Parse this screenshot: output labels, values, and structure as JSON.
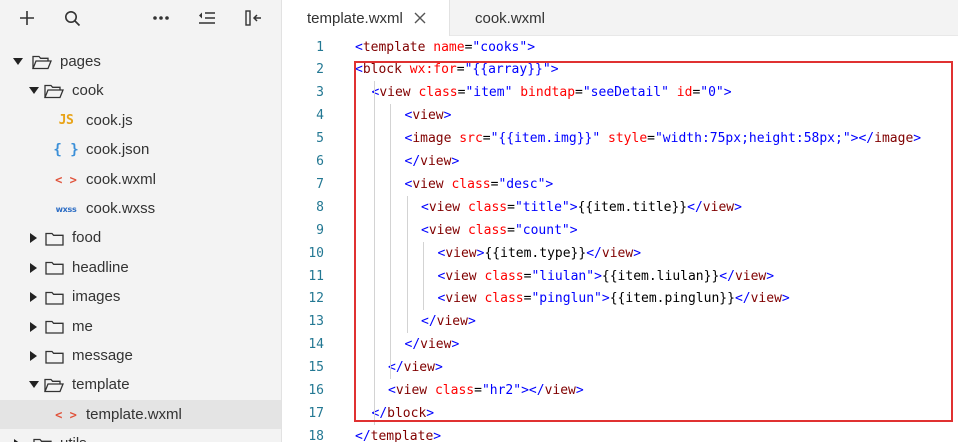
{
  "toolbar": {
    "icons": [
      "plus-icon",
      "search-icon",
      "more-icon",
      "outdent-icon",
      "collapse-panel-icon"
    ]
  },
  "tree": [
    {
      "label": "pages",
      "type": "folder",
      "expanded": true,
      "depth": 0
    },
    {
      "label": "cook",
      "type": "folder",
      "expanded": true,
      "depth": 1
    },
    {
      "label": "cook.js",
      "type": "js",
      "depth": 2
    },
    {
      "label": "cook.json",
      "type": "json",
      "depth": 2
    },
    {
      "label": "cook.wxml",
      "type": "wxml",
      "depth": 2
    },
    {
      "label": "cook.wxss",
      "type": "wxss",
      "depth": 2
    },
    {
      "label": "food",
      "type": "folder",
      "expanded": false,
      "depth": 1
    },
    {
      "label": "headline",
      "type": "folder",
      "expanded": false,
      "depth": 1
    },
    {
      "label": "images",
      "type": "folder",
      "expanded": false,
      "depth": 1
    },
    {
      "label": "me",
      "type": "folder",
      "expanded": false,
      "depth": 1
    },
    {
      "label": "message",
      "type": "folder",
      "expanded": false,
      "depth": 1
    },
    {
      "label": "template",
      "type": "folder",
      "expanded": true,
      "depth": 1
    },
    {
      "label": "template.wxml",
      "type": "wxml",
      "depth": 2,
      "selected": true
    },
    {
      "label": "utils",
      "type": "folder",
      "expanded": false,
      "depth": 0
    }
  ],
  "icon_glyphs": {
    "js": "JS",
    "json": "{ }",
    "wxml": "< >",
    "wxss": "wxss"
  },
  "tabs": [
    {
      "label": "template.wxml",
      "active": true
    },
    {
      "label": "cook.wxml",
      "active": false
    }
  ],
  "code_lines": [
    {
      "n": "1",
      "indent": 0,
      "tokens": [
        [
          "c-tag2",
          "<"
        ],
        [
          "c-tag",
          "template"
        ],
        [
          "c-text",
          " "
        ],
        [
          "c-attr",
          "name"
        ],
        [
          "c-text",
          "="
        ],
        [
          "c-val",
          "\"cooks\""
        ],
        [
          "c-tag2",
          ">"
        ]
      ]
    },
    {
      "n": "2",
      "indent": 0,
      "tokens": [
        [
          "c-tag2",
          "<"
        ],
        [
          "c-tag",
          "block"
        ],
        [
          "c-text",
          " "
        ],
        [
          "c-attr",
          "wx:for"
        ],
        [
          "c-text",
          "="
        ],
        [
          "c-val",
          "\"{{array}}\""
        ],
        [
          "c-tag2",
          ">"
        ]
      ]
    },
    {
      "n": "3",
      "indent": 1,
      "tokens": [
        [
          "c-tag2",
          "<"
        ],
        [
          "c-tag",
          "view"
        ],
        [
          "c-text",
          " "
        ],
        [
          "c-attr",
          "class"
        ],
        [
          "c-text",
          "="
        ],
        [
          "c-val",
          "\"item\""
        ],
        [
          "c-text",
          " "
        ],
        [
          "c-attr",
          "bindtap"
        ],
        [
          "c-text",
          "="
        ],
        [
          "c-val",
          "\"seeDetail\""
        ],
        [
          "c-text",
          " "
        ],
        [
          "c-attr",
          "id"
        ],
        [
          "c-text",
          "="
        ],
        [
          "c-val",
          "\"0\""
        ],
        [
          "c-tag2",
          ">"
        ]
      ]
    },
    {
      "n": "4",
      "indent": 3,
      "tokens": [
        [
          "c-tag2",
          "<"
        ],
        [
          "c-tag",
          "view"
        ],
        [
          "c-tag2",
          ">"
        ]
      ]
    },
    {
      "n": "5",
      "indent": 3,
      "tokens": [
        [
          "c-tag2",
          "<"
        ],
        [
          "c-tag",
          "image"
        ],
        [
          "c-text",
          " "
        ],
        [
          "c-attr",
          "src"
        ],
        [
          "c-text",
          "="
        ],
        [
          "c-val",
          "\"{{item.img}}\""
        ],
        [
          "c-text",
          " "
        ],
        [
          "c-attr",
          "style"
        ],
        [
          "c-text",
          "="
        ],
        [
          "c-val",
          "\"width:75px;height:58px;\""
        ],
        [
          "c-tag2",
          "></"
        ],
        [
          "c-tag",
          "image"
        ],
        [
          "c-tag2",
          ">"
        ]
      ]
    },
    {
      "n": "6",
      "indent": 3,
      "tokens": [
        [
          "c-tag2",
          "</"
        ],
        [
          "c-tag",
          "view"
        ],
        [
          "c-tag2",
          ">"
        ]
      ]
    },
    {
      "n": "7",
      "indent": 3,
      "tokens": [
        [
          "c-tag2",
          "<"
        ],
        [
          "c-tag",
          "view"
        ],
        [
          "c-text",
          " "
        ],
        [
          "c-attr",
          "class"
        ],
        [
          "c-text",
          "="
        ],
        [
          "c-val",
          "\"desc\""
        ],
        [
          "c-tag2",
          ">"
        ]
      ]
    },
    {
      "n": "8",
      "indent": 4,
      "tokens": [
        [
          "c-tag2",
          "<"
        ],
        [
          "c-tag",
          "view"
        ],
        [
          "c-text",
          " "
        ],
        [
          "c-attr",
          "class"
        ],
        [
          "c-text",
          "="
        ],
        [
          "c-val",
          "\"title\""
        ],
        [
          "c-tag2",
          ">"
        ],
        [
          "c-text",
          "{{item.title}}"
        ],
        [
          "c-tag2",
          "</"
        ],
        [
          "c-tag",
          "view"
        ],
        [
          "c-tag2",
          ">"
        ]
      ]
    },
    {
      "n": "9",
      "indent": 4,
      "tokens": [
        [
          "c-tag2",
          "<"
        ],
        [
          "c-tag",
          "view"
        ],
        [
          "c-text",
          " "
        ],
        [
          "c-attr",
          "class"
        ],
        [
          "c-text",
          "="
        ],
        [
          "c-val",
          "\"count\""
        ],
        [
          "c-tag2",
          ">"
        ]
      ]
    },
    {
      "n": "10",
      "indent": 5,
      "tokens": [
        [
          "c-tag2",
          "<"
        ],
        [
          "c-tag",
          "view"
        ],
        [
          "c-tag2",
          ">"
        ],
        [
          "c-text",
          "{{item.type}}"
        ],
        [
          "c-tag2",
          "</"
        ],
        [
          "c-tag",
          "view"
        ],
        [
          "c-tag2",
          ">"
        ]
      ]
    },
    {
      "n": "11",
      "indent": 5,
      "tokens": [
        [
          "c-tag2",
          "<"
        ],
        [
          "c-tag",
          "view"
        ],
        [
          "c-text",
          " "
        ],
        [
          "c-attr",
          "class"
        ],
        [
          "c-text",
          "="
        ],
        [
          "c-val",
          "\"liulan\""
        ],
        [
          "c-tag2",
          ">"
        ],
        [
          "c-text",
          "{{item.liulan}}"
        ],
        [
          "c-tag2",
          "</"
        ],
        [
          "c-tag",
          "view"
        ],
        [
          "c-tag2",
          ">"
        ]
      ]
    },
    {
      "n": "12",
      "indent": 5,
      "tokens": [
        [
          "c-tag2",
          "<"
        ],
        [
          "c-tag",
          "view"
        ],
        [
          "c-text",
          " "
        ],
        [
          "c-attr",
          "class"
        ],
        [
          "c-text",
          "="
        ],
        [
          "c-val",
          "\"pinglun\""
        ],
        [
          "c-tag2",
          ">"
        ],
        [
          "c-text",
          "{{item.pinglun}}"
        ],
        [
          "c-tag2",
          "</"
        ],
        [
          "c-tag",
          "view"
        ],
        [
          "c-tag2",
          ">"
        ]
      ]
    },
    {
      "n": "13",
      "indent": 4,
      "tokens": [
        [
          "c-tag2",
          "</"
        ],
        [
          "c-tag",
          "view"
        ],
        [
          "c-tag2",
          ">"
        ]
      ]
    },
    {
      "n": "14",
      "indent": 3,
      "tokens": [
        [
          "c-tag2",
          "</"
        ],
        [
          "c-tag",
          "view"
        ],
        [
          "c-tag2",
          ">"
        ]
      ]
    },
    {
      "n": "15",
      "indent": 2,
      "tokens": [
        [
          "c-tag2",
          "</"
        ],
        [
          "c-tag",
          "view"
        ],
        [
          "c-tag2",
          ">"
        ]
      ]
    },
    {
      "n": "16",
      "indent": 2,
      "tokens": [
        [
          "c-tag2",
          "<"
        ],
        [
          "c-tag",
          "view"
        ],
        [
          "c-text",
          " "
        ],
        [
          "c-attr",
          "class"
        ],
        [
          "c-text",
          "="
        ],
        [
          "c-val",
          "\"hr2\""
        ],
        [
          "c-tag2",
          "></"
        ],
        [
          "c-tag",
          "view"
        ],
        [
          "c-tag2",
          ">"
        ]
      ]
    },
    {
      "n": "17",
      "indent": 1,
      "tokens": [
        [
          "c-tag2",
          "</"
        ],
        [
          "c-tag",
          "block"
        ],
        [
          "c-tag2",
          ">"
        ]
      ]
    },
    {
      "n": "18",
      "indent": 0,
      "tokens": [
        [
          "c-tag2",
          "</"
        ],
        [
          "c-tag",
          "template"
        ],
        [
          "c-tag2",
          ">"
        ]
      ]
    }
  ],
  "colors": {
    "highlight_border": "#e03131",
    "line_number": "#237893",
    "sidebar_bg": "#f3f3f3",
    "selected_row_bg": "#e4e4e4"
  }
}
